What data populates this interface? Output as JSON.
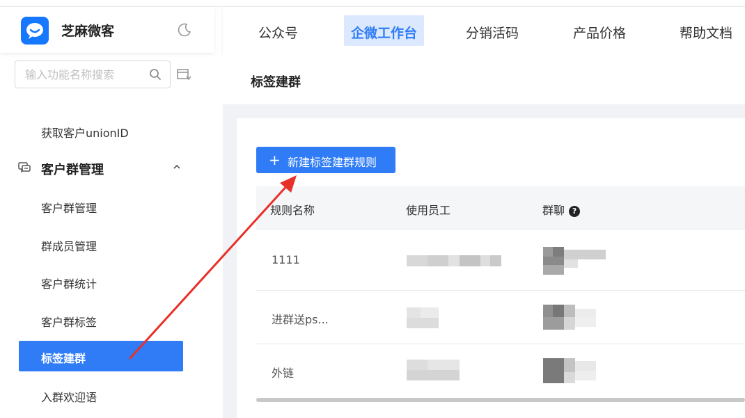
{
  "app": {
    "name": "芝麻微客"
  },
  "search": {
    "placeholder": "输入功能名称搜索"
  },
  "sidebar": {
    "items": [
      {
        "label": "获取客户unionID"
      },
      {
        "label": "客户群管理"
      },
      {
        "label": "群成员管理"
      },
      {
        "label": "客户群统计"
      },
      {
        "label": "客户群标签"
      },
      {
        "label": "标签建群"
      },
      {
        "label": "入群欢迎语"
      }
    ],
    "group": {
      "label": "客户群管理"
    }
  },
  "topnav": {
    "items": [
      {
        "label": "公众号"
      },
      {
        "label": "企微工作台"
      },
      {
        "label": "分销活码"
      },
      {
        "label": "产品价格"
      },
      {
        "label": "帮助文档"
      }
    ]
  },
  "page": {
    "title": "标签建群"
  },
  "toolbar": {
    "new_label": "新建标签建群规则",
    "plus": "+"
  },
  "table": {
    "columns": [
      "规则名称",
      "使用员工",
      "群聊"
    ],
    "help_glyph": "?",
    "rows": [
      {
        "name": "1111"
      },
      {
        "name": "进群送ps..."
      },
      {
        "name": "外链"
      }
    ]
  },
  "colors": {
    "accent": "#2f7cf6",
    "annotation_arrow": "#e8302a"
  }
}
